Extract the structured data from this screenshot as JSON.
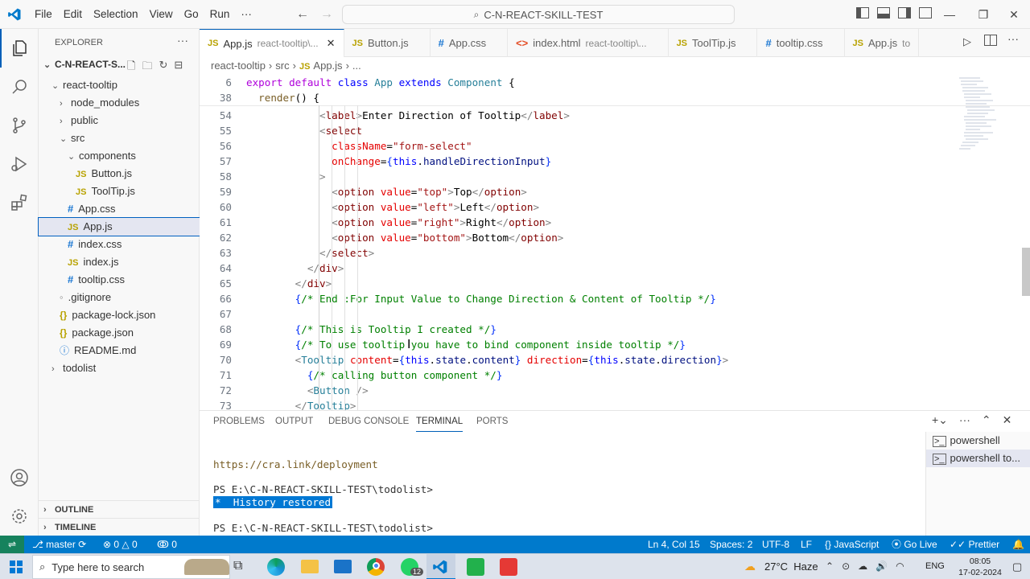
{
  "menu": [
    "File",
    "Edit",
    "Selection",
    "View",
    "Go",
    "Run",
    "···"
  ],
  "search_text": "C-N-REACT-SKILL-TEST",
  "sidebar": {
    "title": "EXPLORER",
    "root": "C-N-REACT-S...",
    "items": [
      {
        "label": "react-tooltip",
        "kind": "folder-open",
        "depth": 1
      },
      {
        "label": "node_modules",
        "kind": "folder",
        "depth": 2
      },
      {
        "label": "public",
        "kind": "folder",
        "depth": 2
      },
      {
        "label": "src",
        "kind": "folder-open",
        "depth": 2
      },
      {
        "label": "components",
        "kind": "folder-open",
        "depth": 3
      },
      {
        "label": "Button.js",
        "kind": "js",
        "depth": 4
      },
      {
        "label": "ToolTip.js",
        "kind": "js",
        "depth": 4
      },
      {
        "label": "App.css",
        "kind": "css",
        "depth": 3
      },
      {
        "label": "App.js",
        "kind": "js",
        "depth": 3,
        "selected": true
      },
      {
        "label": "index.css",
        "kind": "css",
        "depth": 3
      },
      {
        "label": "index.js",
        "kind": "js",
        "depth": 3
      },
      {
        "label": "tooltip.css",
        "kind": "css",
        "depth": 3
      },
      {
        "label": ".gitignore",
        "kind": "dot",
        "depth": 2
      },
      {
        "label": "package-lock.json",
        "kind": "json",
        "depth": 2
      },
      {
        "label": "package.json",
        "kind": "json",
        "depth": 2
      },
      {
        "label": "README.md",
        "kind": "info",
        "depth": 2
      },
      {
        "label": "todolist",
        "kind": "folder",
        "depth": 1
      }
    ],
    "outline": "OUTLINE",
    "timeline": "TIMELINE"
  },
  "tabs": [
    {
      "label": "App.js",
      "sub": "react-tooltip\\...",
      "kind": "js",
      "active": true
    },
    {
      "label": "Button.js",
      "sub": "",
      "kind": "js"
    },
    {
      "label": "App.css",
      "sub": "",
      "kind": "css"
    },
    {
      "label": "index.html",
      "sub": "react-tooltip\\...",
      "kind": "html"
    },
    {
      "label": "ToolTip.js",
      "sub": "",
      "kind": "js"
    },
    {
      "label": "tooltip.css",
      "sub": "",
      "kind": "css"
    },
    {
      "label": "App.js",
      "sub": "to",
      "kind": "js"
    }
  ],
  "breadcrumb": [
    "react-tooltip",
    "src",
    "App.js",
    "..."
  ],
  "code": [
    {
      "n": "6",
      "tokens": [
        [
          "kw2",
          "export "
        ],
        [
          "kw2",
          "default "
        ],
        [
          "kw",
          "class "
        ],
        [
          "cls",
          "App "
        ],
        [
          "kw",
          "extends "
        ],
        [
          "cls",
          "Component "
        ],
        [
          "txt",
          "{"
        ]
      ]
    },
    {
      "n": "38",
      "tokens": [
        [
          "txt",
          "  "
        ],
        [
          "fn",
          "render"
        ],
        [
          "txt",
          "() {"
        ]
      ]
    },
    {
      "n": "54",
      "tokens": [
        [
          "txt",
          "            "
        ],
        [
          "pun",
          "<"
        ],
        [
          "tag",
          "label"
        ],
        [
          "pun",
          ">"
        ],
        [
          "txt",
          "Enter Direction of Tooltip"
        ],
        [
          "pun",
          "</"
        ],
        [
          "tag",
          "label"
        ],
        [
          "pun",
          ">"
        ]
      ]
    },
    {
      "n": "55",
      "tokens": [
        [
          "txt",
          "            "
        ],
        [
          "pun",
          "<"
        ],
        [
          "tag",
          "select"
        ]
      ]
    },
    {
      "n": "56",
      "tokens": [
        [
          "txt",
          "              "
        ],
        [
          "attr",
          "className"
        ],
        [
          "txt",
          "="
        ],
        [
          "str",
          "\"form-select\""
        ]
      ]
    },
    {
      "n": "57",
      "tokens": [
        [
          "txt",
          "              "
        ],
        [
          "attr",
          "onChange"
        ],
        [
          "txt",
          "="
        ],
        [
          "brk",
          "{"
        ],
        [
          "kw",
          "this"
        ],
        [
          "txt",
          "."
        ],
        [
          "var",
          "handleDirectionInput"
        ],
        [
          "brk",
          "}"
        ]
      ]
    },
    {
      "n": "58",
      "tokens": [
        [
          "txt",
          "            "
        ],
        [
          "pun",
          ">"
        ]
      ]
    },
    {
      "n": "59",
      "tokens": [
        [
          "txt",
          "              "
        ],
        [
          "pun",
          "<"
        ],
        [
          "tag",
          "option "
        ],
        [
          "attr",
          "value"
        ],
        [
          "txt",
          "="
        ],
        [
          "str",
          "\"top\""
        ],
        [
          "pun",
          ">"
        ],
        [
          "txt",
          "Top"
        ],
        [
          "pun",
          "</"
        ],
        [
          "tag",
          "option"
        ],
        [
          "pun",
          ">"
        ]
      ]
    },
    {
      "n": "60",
      "tokens": [
        [
          "txt",
          "              "
        ],
        [
          "pun",
          "<"
        ],
        [
          "tag",
          "option "
        ],
        [
          "attr",
          "value"
        ],
        [
          "txt",
          "="
        ],
        [
          "str",
          "\"left\""
        ],
        [
          "pun",
          ">"
        ],
        [
          "txt",
          "Left"
        ],
        [
          "pun",
          "</"
        ],
        [
          "tag",
          "option"
        ],
        [
          "pun",
          ">"
        ]
      ]
    },
    {
      "n": "61",
      "tokens": [
        [
          "txt",
          "              "
        ],
        [
          "pun",
          "<"
        ],
        [
          "tag",
          "option "
        ],
        [
          "attr",
          "value"
        ],
        [
          "txt",
          "="
        ],
        [
          "str",
          "\"right\""
        ],
        [
          "pun",
          ">"
        ],
        [
          "txt",
          "Right"
        ],
        [
          "pun",
          "</"
        ],
        [
          "tag",
          "option"
        ],
        [
          "pun",
          ">"
        ]
      ]
    },
    {
      "n": "62",
      "tokens": [
        [
          "txt",
          "              "
        ],
        [
          "pun",
          "<"
        ],
        [
          "tag",
          "option "
        ],
        [
          "attr",
          "value"
        ],
        [
          "txt",
          "="
        ],
        [
          "str",
          "\"bottom\""
        ],
        [
          "pun",
          ">"
        ],
        [
          "txt",
          "Bottom"
        ],
        [
          "pun",
          "</"
        ],
        [
          "tag",
          "option"
        ],
        [
          "pun",
          ">"
        ]
      ]
    },
    {
      "n": "63",
      "tokens": [
        [
          "txt",
          "            "
        ],
        [
          "pun",
          "</"
        ],
        [
          "tag",
          "select"
        ],
        [
          "pun",
          ">"
        ]
      ]
    },
    {
      "n": "64",
      "tokens": [
        [
          "txt",
          "          "
        ],
        [
          "pun",
          "</"
        ],
        [
          "tag",
          "div"
        ],
        [
          "pun",
          ">"
        ]
      ]
    },
    {
      "n": "65",
      "tokens": [
        [
          "txt",
          "        "
        ],
        [
          "pun",
          "</"
        ],
        [
          "tag",
          "div"
        ],
        [
          "pun",
          ">"
        ]
      ]
    },
    {
      "n": "66",
      "tokens": [
        [
          "txt",
          "        "
        ],
        [
          "brk",
          "{"
        ],
        [
          "cmt",
          "/* End :For Input Value to Change Direction & Content of Tooltip */"
        ],
        [
          "brk",
          "}"
        ]
      ]
    },
    {
      "n": "67",
      "tokens": []
    },
    {
      "n": "68",
      "tokens": [
        [
          "txt",
          "        "
        ],
        [
          "brk",
          "{"
        ],
        [
          "cmt",
          "/* This is Tooltip I created */"
        ],
        [
          "brk",
          "}"
        ]
      ]
    },
    {
      "n": "69",
      "tokens": [
        [
          "txt",
          "        "
        ],
        [
          "brk",
          "{"
        ],
        [
          "cmt",
          "/* To use tooltip you have to bind component inside tooltip */"
        ],
        [
          "brk",
          "}"
        ]
      ]
    },
    {
      "n": "70",
      "tokens": [
        [
          "txt",
          "        "
        ],
        [
          "pun",
          "<"
        ],
        [
          "cls",
          "Tooltip "
        ],
        [
          "attr",
          "content"
        ],
        [
          "txt",
          "="
        ],
        [
          "brk",
          "{"
        ],
        [
          "kw",
          "this"
        ],
        [
          "txt",
          "."
        ],
        [
          "var",
          "state"
        ],
        [
          "txt",
          "."
        ],
        [
          "var",
          "content"
        ],
        [
          "brk",
          "}"
        ],
        [
          "txt",
          " "
        ],
        [
          "attr",
          "direction"
        ],
        [
          "txt",
          "="
        ],
        [
          "brk",
          "{"
        ],
        [
          "kw",
          "this"
        ],
        [
          "txt",
          "."
        ],
        [
          "var",
          "state"
        ],
        [
          "txt",
          "."
        ],
        [
          "var",
          "direction"
        ],
        [
          "brk",
          "}"
        ],
        [
          "pun",
          ">"
        ]
      ]
    },
    {
      "n": "71",
      "tokens": [
        [
          "txt",
          "          "
        ],
        [
          "brk",
          "{"
        ],
        [
          "cmt",
          "/* calling button component */"
        ],
        [
          "brk",
          "}"
        ]
      ]
    },
    {
      "n": "72",
      "tokens": [
        [
          "txt",
          "          "
        ],
        [
          "pun",
          "<"
        ],
        [
          "cls",
          "Button "
        ],
        [
          "pun",
          "/>"
        ]
      ]
    },
    {
      "n": "73",
      "tokens": [
        [
          "txt",
          "        "
        ],
        [
          "pun",
          "</"
        ],
        [
          "cls",
          "Tooltip"
        ],
        [
          "pun",
          ">"
        ]
      ]
    }
  ],
  "panel": {
    "tabs": [
      "PROBLEMS",
      "OUTPUT",
      "DEBUG CONSOLE",
      "TERMINAL",
      "PORTS"
    ],
    "active_tab": "TERMINAL",
    "terminal_lines": [
      "https://cra.link/deployment",
      "PS E:\\C-N-REACT-SKILL-TEST\\todolist>",
      "*  History restored",
      "PS E:\\C-N-REACT-SKILL-TEST\\todolist>"
    ],
    "terminals": [
      "powershell",
      "powershell to..."
    ]
  },
  "status": {
    "branch": "master",
    "sync": "⟳",
    "errors": "0",
    "warnings": "0",
    "ports": "0",
    "position": "Ln 4, Col 15",
    "spaces": "Spaces: 2",
    "encoding": "UTF-8",
    "eol": "LF",
    "language": "JavaScript",
    "golive": "Go Live",
    "prettier": "Prettier"
  },
  "taskbar": {
    "search_placeholder": "Type here to search",
    "weather": "27°C  Haze",
    "lang": "ENG",
    "time": "08:05",
    "date": "17-02-2024",
    "whatsapp_badge": "12"
  },
  "colors": {
    "accent": "#007acc",
    "selection": "#e4e6f1"
  }
}
